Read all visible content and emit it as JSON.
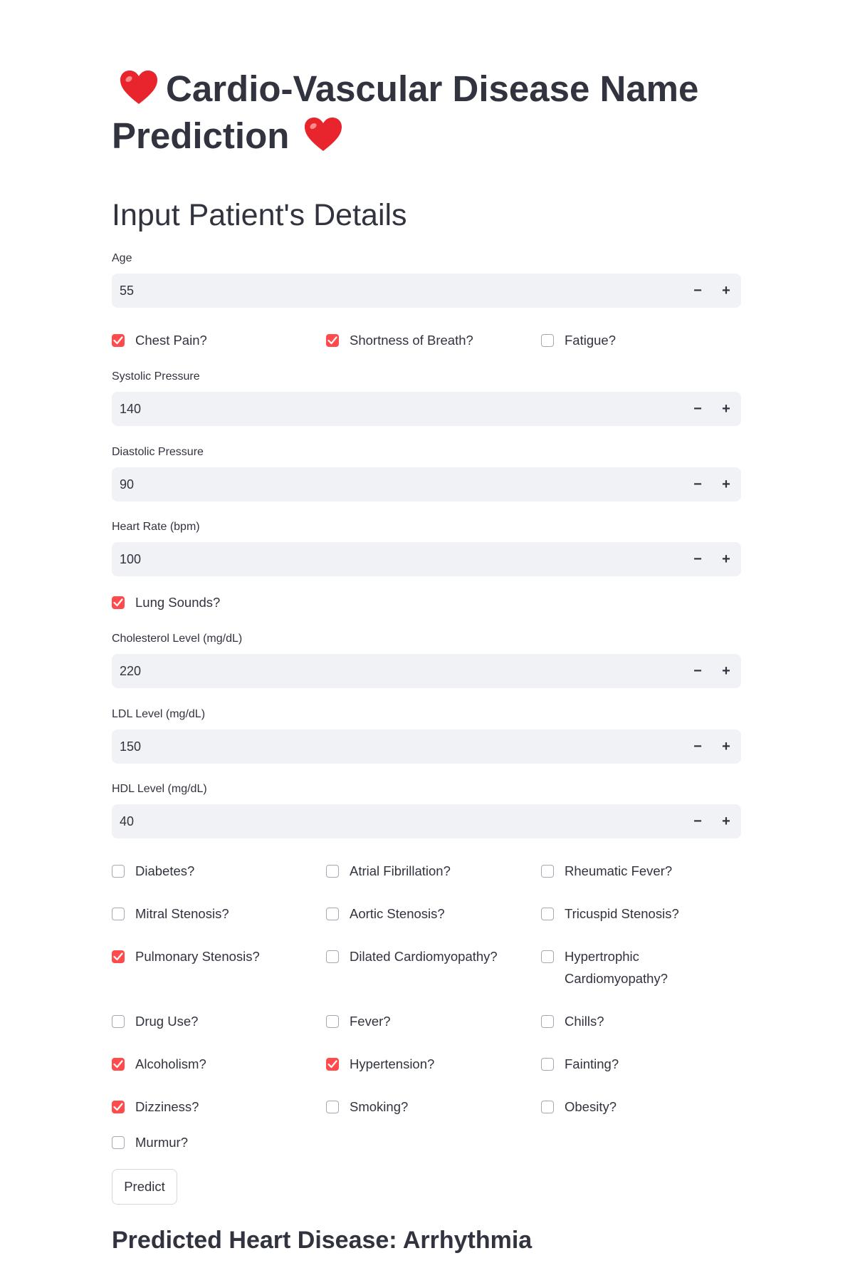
{
  "page": {
    "title_part1": "Cardio-Vascular Disease Name",
    "title_part2": "Prediction",
    "subheader": "Input Patient's Details"
  },
  "fields": {
    "age": {
      "label": "Age",
      "value": "55"
    },
    "systolic": {
      "label": "Systolic Pressure",
      "value": "140"
    },
    "diastolic": {
      "label": "Diastolic Pressure",
      "value": "90"
    },
    "heart_rate": {
      "label": "Heart Rate (bpm)",
      "value": "100"
    },
    "cholesterol": {
      "label": "Cholesterol Level (mg/dL)",
      "value": "220"
    },
    "ldl": {
      "label": "LDL Level (mg/dL)",
      "value": "150"
    },
    "hdl": {
      "label": "HDL Level (mg/dL)",
      "value": "40"
    }
  },
  "stepper": {
    "minus": "−",
    "plus": "+"
  },
  "checkboxes": {
    "chest_pain": {
      "label": "Chest Pain?",
      "checked": true
    },
    "shortness_of_breath": {
      "label": "Shortness of Breath?",
      "checked": true
    },
    "fatigue": {
      "label": "Fatigue?",
      "checked": false
    },
    "lung_sounds": {
      "label": "Lung Sounds?",
      "checked": true
    },
    "diabetes": {
      "label": "Diabetes?",
      "checked": false
    },
    "atrial_fibrillation": {
      "label": "Atrial Fibrillation?",
      "checked": false
    },
    "rheumatic_fever": {
      "label": "Rheumatic Fever?",
      "checked": false
    },
    "mitral_stenosis": {
      "label": "Mitral Stenosis?",
      "checked": false
    },
    "aortic_stenosis": {
      "label": "Aortic Stenosis?",
      "checked": false
    },
    "tricuspid_stenosis": {
      "label": "Tricuspid Stenosis?",
      "checked": false
    },
    "pulmonary_stenosis": {
      "label": "Pulmonary Stenosis?",
      "checked": true
    },
    "dilated_cardiomyopathy": {
      "label": "Dilated Cardiomyopathy?",
      "checked": false
    },
    "hypertrophic_cardiomyopathy": {
      "label": "Hypertrophic Cardiomyopathy?",
      "checked": false
    },
    "drug_use": {
      "label": "Drug Use?",
      "checked": false
    },
    "fever": {
      "label": "Fever?",
      "checked": false
    },
    "chills": {
      "label": "Chills?",
      "checked": false
    },
    "alcoholism": {
      "label": "Alcoholism?",
      "checked": true
    },
    "hypertension": {
      "label": "Hypertension?",
      "checked": true
    },
    "fainting": {
      "label": "Fainting?",
      "checked": false
    },
    "dizziness": {
      "label": "Dizziness?",
      "checked": true
    },
    "smoking": {
      "label": "Smoking?",
      "checked": false
    },
    "obesity": {
      "label": "Obesity?",
      "checked": false
    },
    "murmur": {
      "label": "Murmur?",
      "checked": false
    }
  },
  "predict_button": "Predict",
  "result": "Predicted Heart Disease: Arrhythmia",
  "colors": {
    "accent": "#ff4b4b",
    "input_bg": "#f0f2f6",
    "text": "#31333f"
  }
}
